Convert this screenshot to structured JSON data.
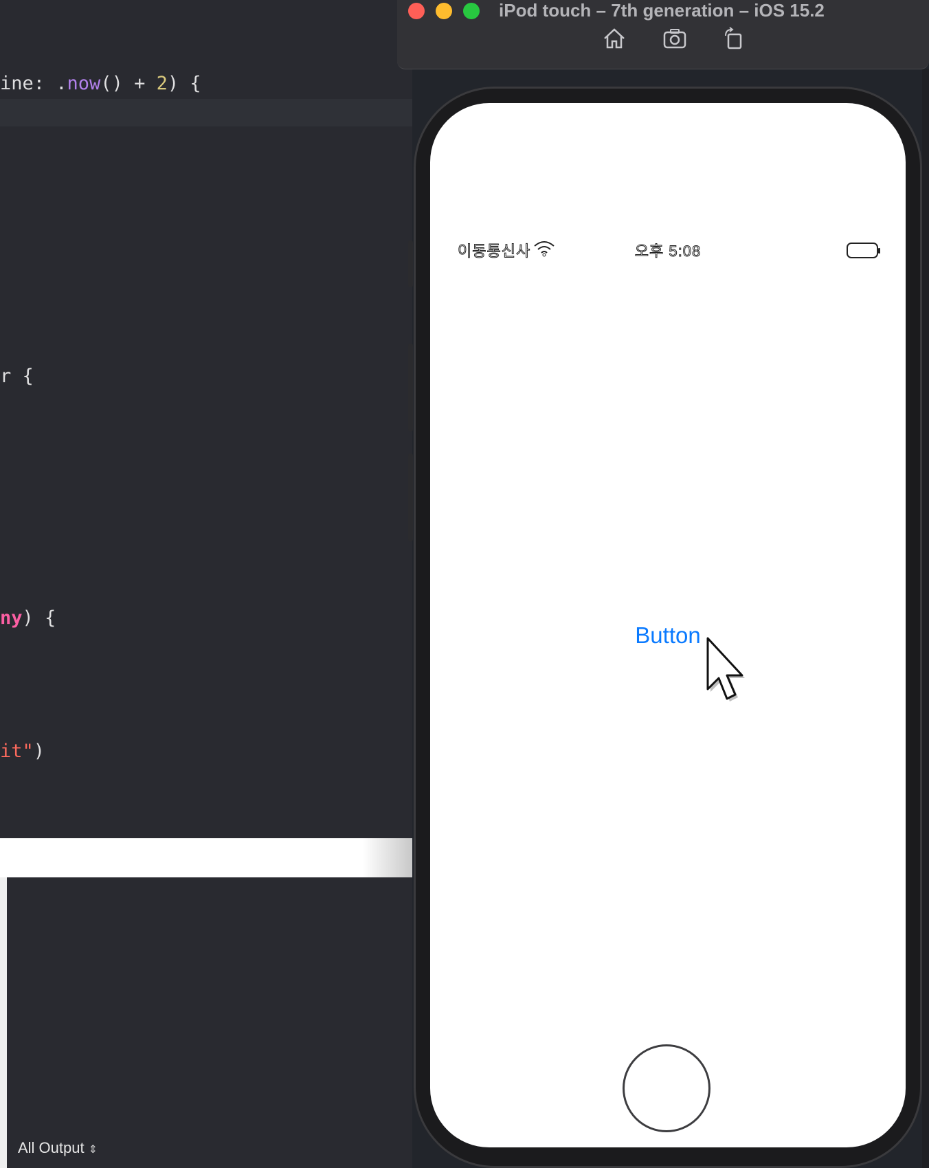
{
  "editor": {
    "lines": [
      {
        "seg1": "ine: ",
        "seg2": ".",
        "method": "now",
        "seg3": "() + ",
        "num": "2",
        "seg4": ") {"
      },
      {
        "text": "r {"
      },
      {
        "kw": "ny",
        "rest": ") {"
      },
      {
        "str": "it\"",
        "rest": ")"
      }
    ]
  },
  "console": {
    "output_filter_label": "All Output",
    "output_filter_icon": "updown-chevron-icon"
  },
  "simulator": {
    "title": "iPod touch – 7th generation – iOS 15.2",
    "toolbar": [
      "home-icon",
      "screenshot-icon",
      "rotate-icon"
    ],
    "status_bar": {
      "carrier": "이동통신사",
      "time": "오후 5:08"
    },
    "app": {
      "button_label": "Button"
    },
    "colors": {
      "tint": "#0a7aff",
      "traffic_close": "#fe5f57",
      "traffic_minimize": "#febc2e",
      "traffic_zoom": "#28c840"
    }
  }
}
